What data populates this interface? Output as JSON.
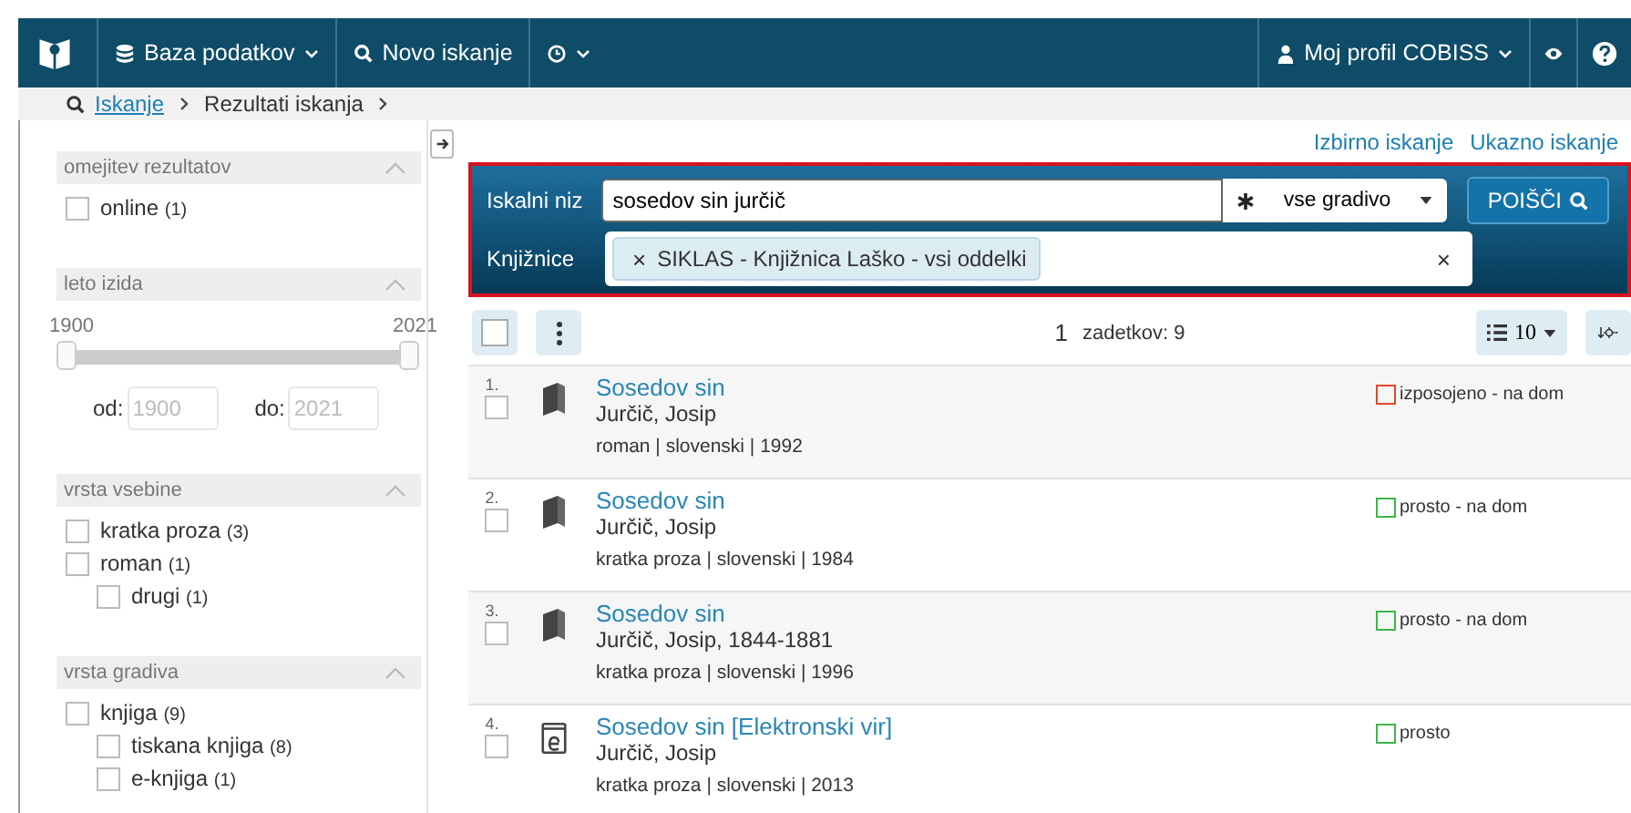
{
  "navbar": {
    "left": [
      {
        "kind": "database",
        "label": "Baza podatkov"
      },
      {
        "kind": "search",
        "label": "Novo iskanje"
      },
      {
        "kind": "history"
      }
    ],
    "profile": "Moj profil COBISS"
  },
  "breadcrumb": {
    "link": "Iskanje",
    "current": "Rezultati iskanja"
  },
  "search_links": [
    "Izbirno iskanje",
    "Ukazno iskanje"
  ],
  "facets": [
    {
      "kind": "list",
      "title": "omejitev rezultatov",
      "items": [
        {
          "label": "online",
          "count": "(1)",
          "checked": false
        }
      ]
    },
    {
      "kind": "range",
      "title": "leto izida",
      "min": "1900",
      "max": "2021",
      "thumbs": [
        {
          "level": 0
        },
        {
          "level": 1
        }
      ],
      "from_label": "od:",
      "from": "1900",
      "to_label": "do:",
      "to": "2021"
    },
    {
      "kind": "list",
      "title": "vrsta vsebine",
      "items": [
        {
          "label": "kratka proza",
          "count": "(3)",
          "checked": false
        },
        {
          "label": "roman",
          "count": "(1)",
          "checked": false,
          "children": [
            {
              "label": "drugi",
              "count": "(1)",
              "checked": false
            }
          ]
        }
      ]
    },
    {
      "kind": "list",
      "title": "vrsta gradiva",
      "items": [
        {
          "label": "knjiga",
          "count": "(9)",
          "checked": false,
          "children": [
            {
              "label": "tiskana knjiga",
              "count": "(8)",
              "checked": false
            },
            {
              "label": "e-knjiga",
              "count": "(1)",
              "checked": false
            }
          ]
        }
      ]
    }
  ],
  "search": {
    "query_label": "Iskalni niz",
    "query": "sosedov sin jurčič",
    "material": "vse gradivo",
    "button": "POIŠČI",
    "libraries_label": "Knjižnice",
    "library_tag": "SIKLAS - Knjižnica Laško - vsi oddelki",
    "clear": "×",
    "tag_remove": "×"
  },
  "toolbar": {
    "page": "1",
    "hits": "zadetkov: 9",
    "per_page": "10"
  },
  "results": [
    {
      "number": "1.",
      "kind": "book",
      "title": "Sosedov sin",
      "author": "Jurčič, Josip",
      "meta": "roman | slovenski | 1992",
      "status": "izposojeno - na dom",
      "color": "#e0492c",
      "checked": false
    },
    {
      "number": "2.",
      "kind": "book",
      "title": "Sosedov sin",
      "author": "Jurčič, Josip",
      "meta": "kratka proza | slovenski | 1984",
      "status": "prosto - na dom",
      "color": "#3cb64a",
      "checked": false
    },
    {
      "number": "3.",
      "kind": "book",
      "title": "Sosedov sin",
      "author": "Jurčič, Josip, 1844-1881",
      "meta": "kratka proza | slovenski | 1996",
      "status": "prosto - na dom",
      "color": "#3cb64a",
      "checked": false
    },
    {
      "number": "4.",
      "kind": "ebook",
      "title": "Sosedov sin [Elektronski vir]",
      "author": "Jurčič, Josip",
      "meta": "kratka proza | slovenski | 2013",
      "status": "prosto",
      "color": "#3cb64a",
      "checked": false
    }
  ]
}
